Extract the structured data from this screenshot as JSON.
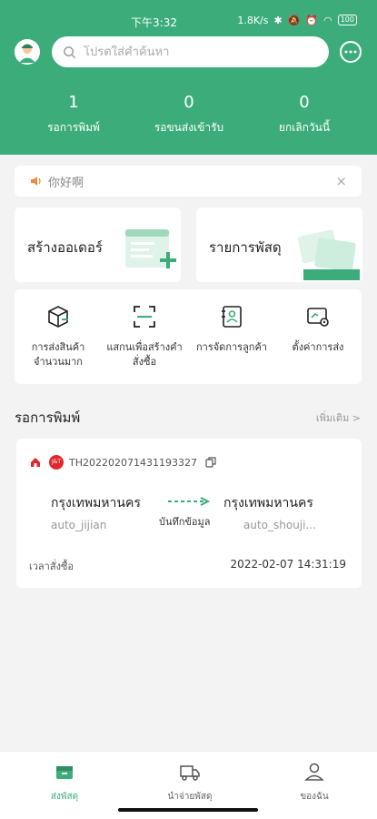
{
  "status_bar": {
    "time": "下午3:32",
    "network_speed": "1.8K/s",
    "icons": [
      "bluetooth-icon",
      "mute-icon",
      "alarm-icon",
      "wifi-icon"
    ],
    "battery": "100"
  },
  "header": {
    "search_placeholder": "โปรดใส่คำค้นหา",
    "stats": [
      {
        "value": "1",
        "label": "รอการพิมพ์"
      },
      {
        "value": "0",
        "label": "รอขนส่งเข้ารับ"
      },
      {
        "value": "0",
        "label": "ยกเลิกวันนี้"
      }
    ]
  },
  "notice": {
    "text": "你好啊",
    "close": "×"
  },
  "cards": {
    "create_order": "สร้างออเดอร์",
    "parcel_list": "รายการพัสดุ"
  },
  "actions": [
    {
      "label_line1": "การส่งสินค้า",
      "label_line2": "จำนวนมาก",
      "icon": "box-icon"
    },
    {
      "label_line1": "แสกนเพื่อสร้างคำ",
      "label_line2": "สั่งซื้อ",
      "icon": "scan-icon"
    },
    {
      "label_line1": "การจัดการลูกค้า",
      "label_line2": "",
      "icon": "contacts-icon"
    },
    {
      "label_line1": "ตั้งค่าการส่ง",
      "label_line2": "",
      "icon": "settings-icon"
    }
  ],
  "pending_section": {
    "title": "รอการพิมพ์",
    "more": "เพิ่มเติม >"
  },
  "order": {
    "courier_badge": "J&T",
    "tracking_no": "TH202202071431193327",
    "from_city": "กรุงเทพมหานคร",
    "from_user": "auto_jijian",
    "to_city": "กรุงเทพมหานคร",
    "to_user": "auto_shouji...",
    "arrow_label": "บันทึกข้อมูล",
    "time_label": "เวลาสั่งซื้อ",
    "time_value": "2022-02-07 14:31:19"
  },
  "tabbar": {
    "tabs": [
      {
        "label": "ส่งพัสดุ",
        "active": true
      },
      {
        "label": "นำจ่ายพัสดุ",
        "active": false
      },
      {
        "label": "ของฉัน",
        "active": false
      }
    ]
  },
  "colors": {
    "primary": "#3cad7a",
    "courier_red": "#e0262d",
    "notice_orange": "#f08b3a"
  }
}
